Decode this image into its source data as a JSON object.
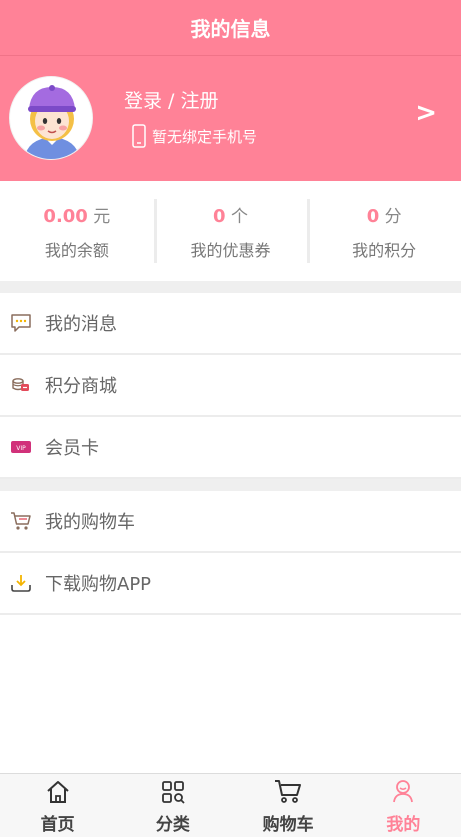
{
  "header": {
    "title": "我的信息"
  },
  "profile": {
    "login_label": "登录 / 注册",
    "phone_status": "暂无绑定手机号",
    "chevron": ">"
  },
  "stats": [
    {
      "value": "0.00",
      "unit": "元",
      "label": "我的余额"
    },
    {
      "value": "0",
      "unit": "个",
      "label": "我的优惠券"
    },
    {
      "value": "0",
      "unit": "分",
      "label": "我的积分"
    }
  ],
  "menu_group_1": [
    {
      "label": "我的消息",
      "icon": "message-icon"
    },
    {
      "label": "积分商城",
      "icon": "coins-icon"
    },
    {
      "label": "会员卡",
      "icon": "vip-card-icon",
      "icon_text": "VIP"
    }
  ],
  "menu_group_2": [
    {
      "label": "我的购物车",
      "icon": "cart-icon"
    },
    {
      "label": "下载购物APP",
      "icon": "download-icon"
    }
  ],
  "tabbar": [
    {
      "label": "首页",
      "icon": "home-icon"
    },
    {
      "label": "分类",
      "icon": "category-icon"
    },
    {
      "label": "购物车",
      "icon": "cart-icon"
    },
    {
      "label": "我的",
      "icon": "user-icon",
      "active": true
    }
  ],
  "colors": {
    "accent": "#ff8297",
    "background": "#ffffff",
    "divider": "#efefef"
  }
}
